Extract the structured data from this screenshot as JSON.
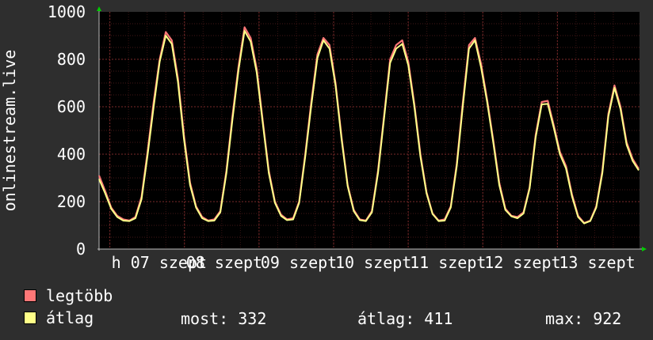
{
  "chart_data": {
    "type": "line",
    "ylabel": "onlinestream.live",
    "ylim": [
      0,
      1000
    ],
    "y_ticks": [
      "0",
      "200",
      "400",
      "600",
      "800",
      "1000"
    ],
    "x_tick_labels": [
      "h 07 szept",
      "08 szept",
      "09 szept",
      "10 szept",
      "11 szept",
      "12 szept",
      "13 szept"
    ],
    "colors": {
      "background": "#2e2e2e",
      "plot": "#000000",
      "grid": "#7a2a2a",
      "max": "#ff7777",
      "avg": "#ffff88",
      "axis_arrow": "#00cc00"
    },
    "grid": true,
    "series": [
      {
        "name": "legtöbb",
        "color": "#ff7777",
        "values": [
          310,
          245,
          175,
          140,
          125,
          120,
          135,
          220,
          410,
          620,
          800,
          915,
          880,
          720,
          480,
          280,
          180,
          135,
          120,
          125,
          160,
          330,
          560,
          770,
          935,
          890,
          760,
          540,
          330,
          200,
          145,
          125,
          130,
          200,
          400,
          620,
          820,
          890,
          860,
          700,
          470,
          270,
          165,
          125,
          120,
          160,
          330,
          560,
          800,
          860,
          880,
          790,
          610,
          400,
          240,
          150,
          120,
          125,
          180,
          360,
          620,
          860,
          890,
          780,
          630,
          460,
          280,
          170,
          140,
          135,
          155,
          260,
          480,
          620,
          625,
          520,
          410,
          350,
          230,
          140,
          110,
          120,
          180,
          330,
          570,
          690,
          600,
          450,
          380,
          338
        ]
      },
      {
        "name": "átlag",
        "color": "#ffff88",
        "values": [
          295,
          235,
          170,
          135,
          120,
          118,
          130,
          210,
          395,
          600,
          790,
          900,
          865,
          705,
          465,
          270,
          175,
          130,
          118,
          120,
          155,
          320,
          545,
          755,
          920,
          875,
          745,
          530,
          320,
          195,
          140,
          122,
          125,
          195,
          390,
          605,
          805,
          880,
          845,
          690,
          460,
          265,
          160,
          122,
          118,
          155,
          320,
          550,
          785,
          845,
          865,
          775,
          600,
          390,
          235,
          148,
          118,
          120,
          175,
          350,
          605,
          845,
          880,
          765,
          620,
          450,
          270,
          165,
          138,
          130,
          150,
          255,
          470,
          610,
          612,
          510,
          400,
          340,
          222,
          135,
          108,
          118,
          175,
          320,
          560,
          680,
          590,
          440,
          372,
          332
        ]
      }
    ]
  },
  "legend": {
    "max_label": "legtöbb",
    "avg_label": "átlag",
    "now": "most: 332",
    "average": "átlag: 411",
    "maximum": "max: 922"
  }
}
